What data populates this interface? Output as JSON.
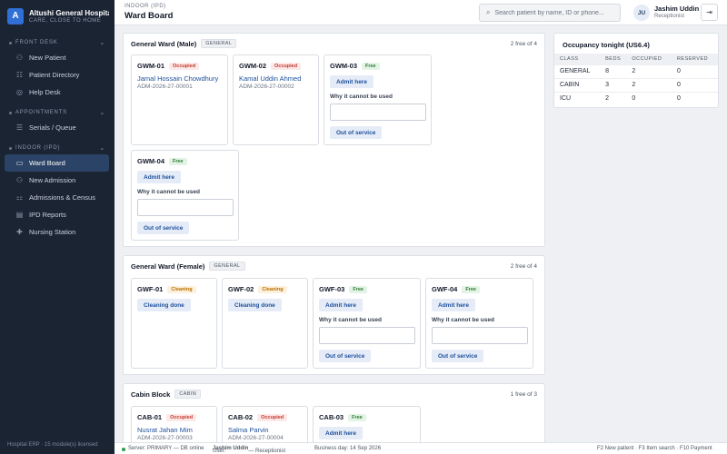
{
  "brand": {
    "logo_letter": "A",
    "name": "Altushi General Hospital",
    "tagline": "CARE, CLOSE TO HOME"
  },
  "sidebar": {
    "sections": [
      {
        "title": "FRONT DESK",
        "items": [
          {
            "label": "New Patient",
            "icon": "person-plus-icon"
          },
          {
            "label": "Patient Directory",
            "icon": "users-icon"
          },
          {
            "label": "Help Desk",
            "icon": "help-icon"
          }
        ]
      },
      {
        "title": "APPOINTMENTS",
        "items": [
          {
            "label": "Serials / Queue",
            "icon": "list-icon"
          }
        ]
      },
      {
        "title": "INDOOR (IPD)",
        "items": [
          {
            "label": "Ward Board",
            "icon": "bed-icon",
            "active": true
          },
          {
            "label": "New Admission",
            "icon": "person-plus-icon"
          },
          {
            "label": "Admissions & Census",
            "icon": "census-icon"
          },
          {
            "label": "IPD Reports",
            "icon": "report-icon"
          },
          {
            "label": "Nursing Station",
            "icon": "nurse-icon"
          }
        ]
      }
    ],
    "footer": "Hospital ERP · 15 module(s) licensed"
  },
  "header": {
    "breadcrumb": "INDOOR (IPD)",
    "title": "Ward Board",
    "search_placeholder": "Search patient by name, ID or phone...",
    "user": {
      "initials": "JU",
      "name": "Jashim Uddin",
      "role": "Receptionist"
    }
  },
  "labels": {
    "admit": "Admit here",
    "why": "Why it cannot be used",
    "oos": "Out of service",
    "cleaning_done": "Cleaning done"
  },
  "wards": [
    {
      "name": "General Ward (Male)",
      "tag": "GENERAL",
      "free_text": "2 free of 4",
      "beds": [
        {
          "id": "GWM-01",
          "status": "Occupied",
          "patient": "Jamal Hossain Chowdhury",
          "adm": "ADM-2026-27-00001"
        },
        {
          "id": "GWM-02",
          "status": "Occupied",
          "patient": "Kamal Uddin Ahmed",
          "adm": "ADM-2026-27-00002"
        },
        {
          "id": "GWM-03",
          "status": "Free"
        },
        {
          "id": "GWM-04",
          "status": "Free"
        }
      ]
    },
    {
      "name": "General Ward (Female)",
      "tag": "GENERAL",
      "free_text": "2 free of 4",
      "beds": [
        {
          "id": "GWF-01",
          "status": "Cleaning"
        },
        {
          "id": "GWF-02",
          "status": "Cleaning"
        },
        {
          "id": "GWF-03",
          "status": "Free"
        },
        {
          "id": "GWF-04",
          "status": "Free"
        }
      ]
    },
    {
      "name": "Cabin Block",
      "tag": "CABIN",
      "free_text": "1 free of 3",
      "beds": [
        {
          "id": "CAB-01",
          "status": "Occupied",
          "patient": "Nusrat Jahan Mim",
          "adm": "ADM-2026-27-00003"
        },
        {
          "id": "CAB-02",
          "status": "Occupied",
          "patient": "Salma Parvin",
          "adm": "ADM-2026-27-00004"
        },
        {
          "id": "CAB-03",
          "status": "Free"
        }
      ]
    }
  ],
  "occupancy": {
    "title": "Occupancy tonight (US6.4)",
    "columns": [
      "CLASS",
      "BEDS",
      "OCCUPIED",
      "RESERVED"
    ],
    "rows": [
      [
        "GENERAL",
        "8",
        "2",
        "0"
      ],
      [
        "CABIN",
        "3",
        "2",
        "0"
      ],
      [
        "ICU",
        "2",
        "0",
        "0"
      ]
    ]
  },
  "statusbar": {
    "server": "Server: PRIMARY — DB online",
    "user_prefix": "User: ",
    "user_name": "Jashim Uddin",
    "user_suffix": " — Receptionist",
    "business_day": "Business day: 14 Sep 2026",
    "shortcuts": "F2 New patient · F3 Item search · F10 Payment"
  },
  "colors": {
    "sidebar_bg": "#1b2433",
    "accent": "#2f6fd6",
    "occupied": "#c0392b",
    "free": "#2e7d32",
    "cleaning": "#b86e00"
  }
}
